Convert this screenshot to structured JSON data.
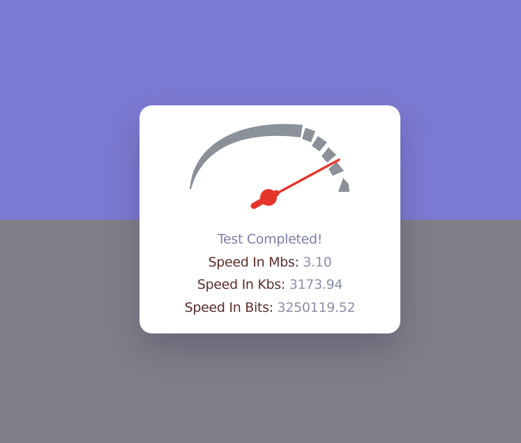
{
  "colors": {
    "background_top": "#7c7bd3",
    "background_bottom": "#807f88",
    "card": "#ffffff",
    "gauge_arc": "#8a9198",
    "needle": "#e4362a",
    "status_text": "#7b7fa6",
    "label_text": "#5a2d2a",
    "value_text": "#8a8ea9"
  },
  "gauge": {
    "icon": "speedometer-gauge"
  },
  "result": {
    "status": "Test Completed!",
    "mbs_label": "Speed In Mbs:",
    "mbs_value": "3.10",
    "kbs_label": "Speed In Kbs:",
    "kbs_value": "3173.94",
    "bits_label": "Speed In Bits:",
    "bits_value": "3250119.52"
  }
}
